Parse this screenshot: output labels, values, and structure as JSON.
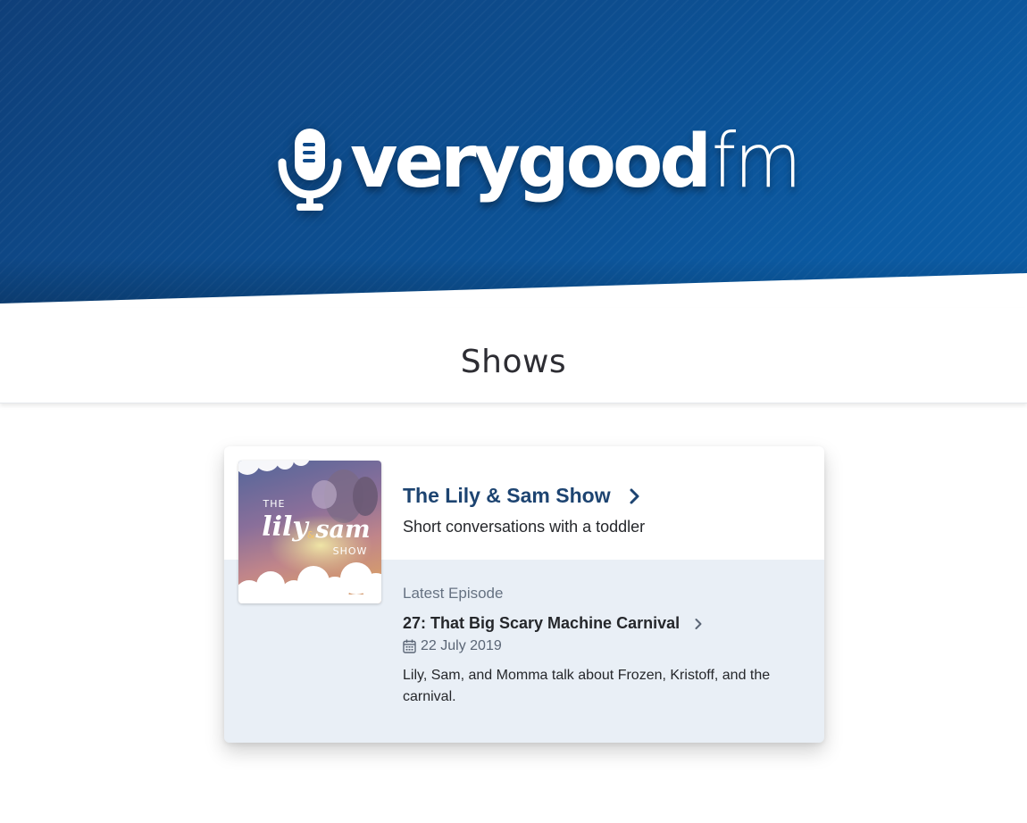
{
  "brand": {
    "name_bold": "verygood",
    "name_light": "fm",
    "primary_color": "#0c4f8f",
    "icon": "microphone-icon"
  },
  "section": {
    "title": "Shows"
  },
  "shows": [
    {
      "title": "The Lily & Sam Show",
      "description": "Short conversations with a toddler",
      "cover_art": {
        "text_the": "THE",
        "text_lily": "lily",
        "text_amp": "&",
        "text_sam": "sam",
        "text_show": "SHOW"
      },
      "latest_episode": {
        "label": "Latest Episode",
        "title": "27: That Big Scary Machine Carnival",
        "date": "22 July 2019",
        "description": "Lily, Sam, and Momma talk about Frozen, Kristoff, and the carnival."
      }
    }
  ]
}
